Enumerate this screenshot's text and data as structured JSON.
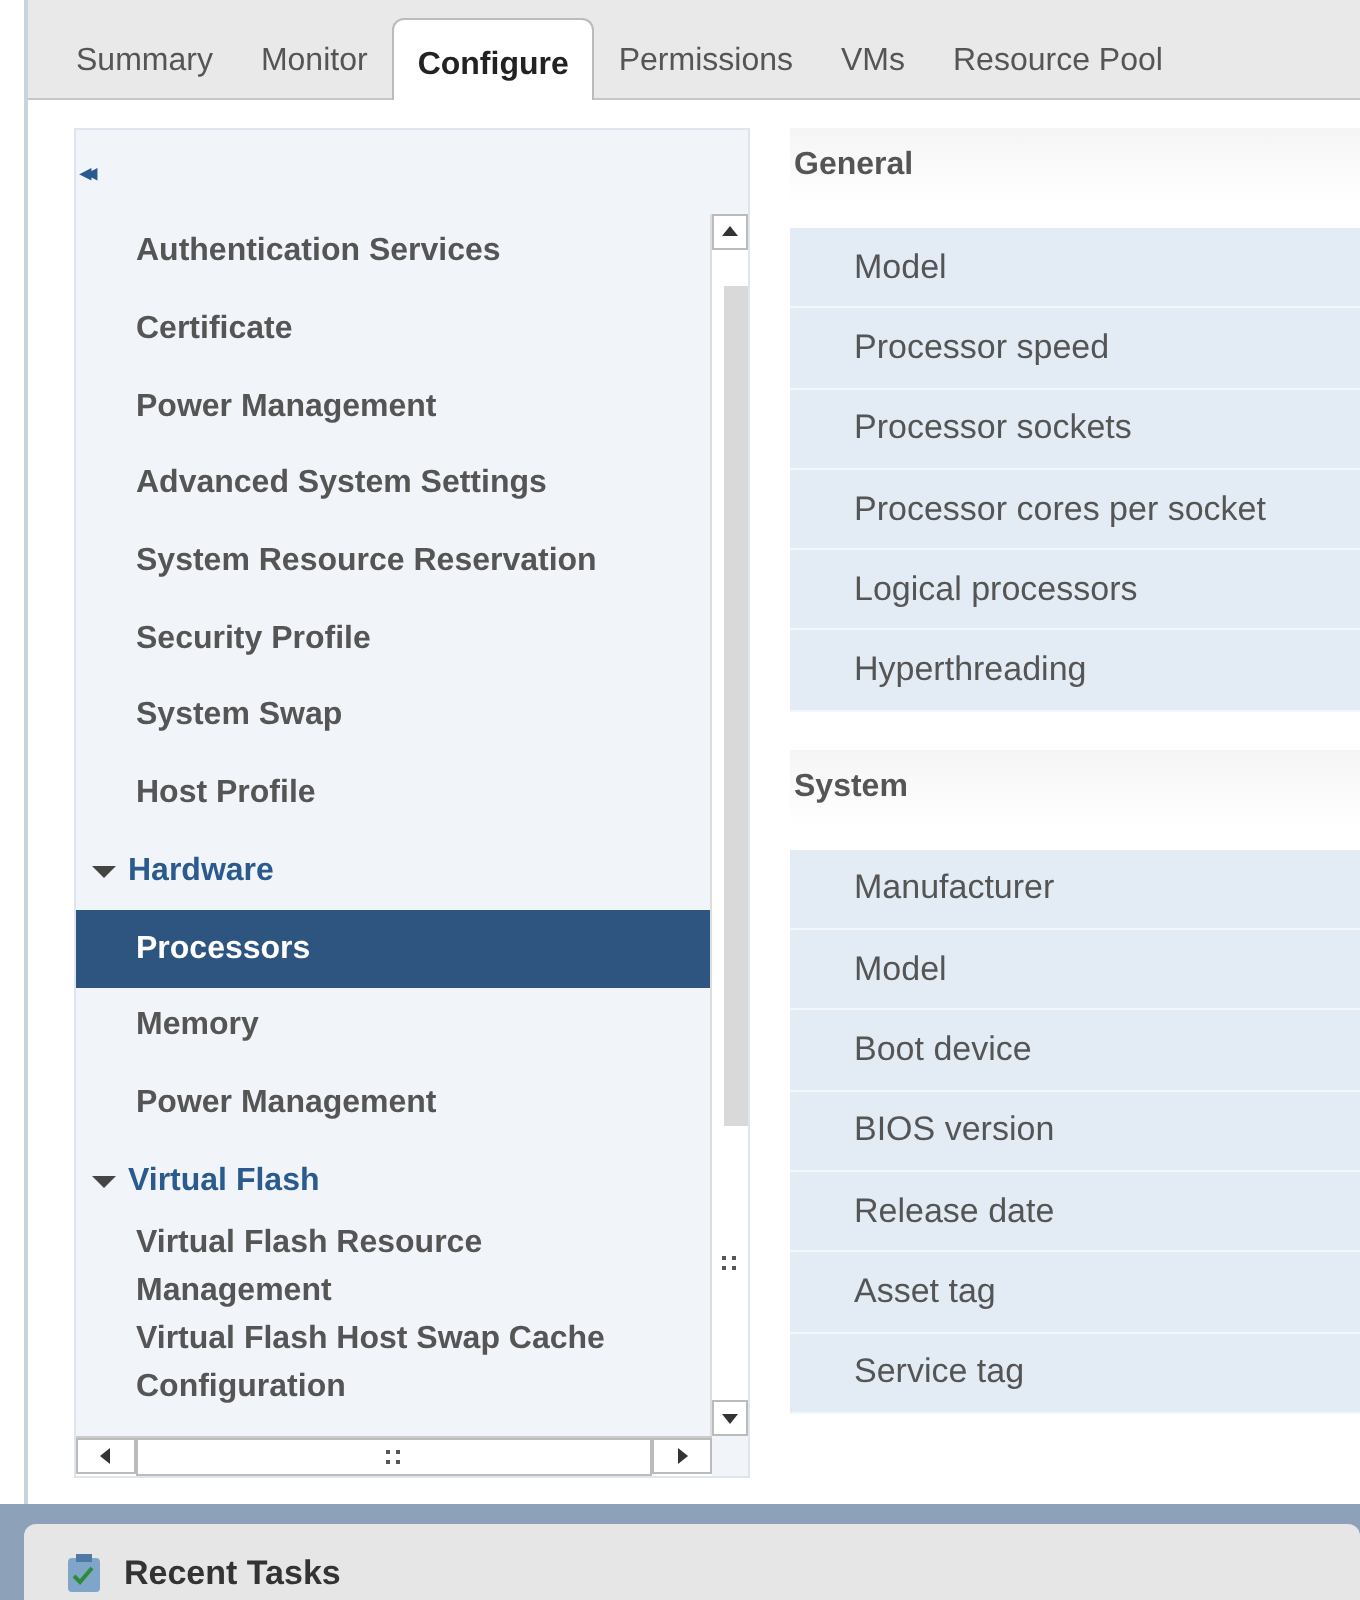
{
  "tabs": [
    {
      "label": "Summary",
      "selected": false
    },
    {
      "label": "Monitor",
      "selected": false
    },
    {
      "label": "Configure",
      "selected": true
    },
    {
      "label": "Permissions",
      "selected": false
    },
    {
      "label": "VMs",
      "selected": false
    },
    {
      "label": "Resource Pool",
      "selected": false
    }
  ],
  "nav": {
    "collapse_symbol": "◂◂",
    "items": [
      {
        "kind": "item",
        "label": "Authentication Services",
        "selected": false
      },
      {
        "kind": "item",
        "label": "Certificate",
        "selected": false
      },
      {
        "kind": "item",
        "label": "Power Management",
        "selected": false
      },
      {
        "kind": "item",
        "label": "Advanced System Settings",
        "selected": false
      },
      {
        "kind": "item",
        "label": "System Resource Reservation",
        "selected": false
      },
      {
        "kind": "item",
        "label": "Security Profile",
        "selected": false
      },
      {
        "kind": "item",
        "label": "System Swap",
        "selected": false
      },
      {
        "kind": "item",
        "label": "Host Profile",
        "selected": false
      },
      {
        "kind": "group",
        "label": "Hardware",
        "expanded": true,
        "children": [
          {
            "kind": "item",
            "label": "Processors",
            "selected": true
          },
          {
            "kind": "item",
            "label": "Memory",
            "selected": false
          },
          {
            "kind": "item",
            "label": "Power Management",
            "selected": false
          }
        ]
      },
      {
        "kind": "group",
        "label": "Virtual Flash",
        "expanded": true,
        "children": [
          {
            "kind": "item",
            "label": "Virtual Flash Resource Management",
            "selected": false
          },
          {
            "kind": "item",
            "label": "Virtual Flash Host Swap Cache Configuration",
            "selected": false
          }
        ]
      }
    ]
  },
  "sections": [
    {
      "title": "General",
      "rows": [
        "Model",
        "Processor speed",
        "Processor sockets",
        "Processor cores per socket",
        "Logical processors",
        "Hyperthreading"
      ]
    },
    {
      "title": "System",
      "rows": [
        "Manufacturer",
        "Model",
        "Boot device",
        "BIOS version",
        "Release date",
        "Asset tag",
        "Service tag"
      ]
    }
  ],
  "recent_tasks": {
    "title": "Recent Tasks"
  }
}
